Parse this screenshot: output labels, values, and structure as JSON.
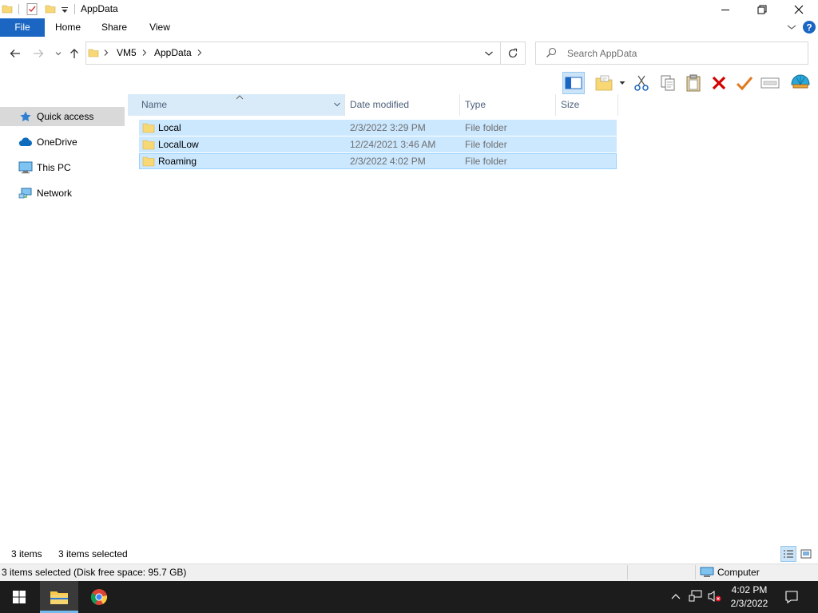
{
  "window": {
    "title": "AppData"
  },
  "ribbon": {
    "tabs": [
      {
        "label": "File"
      },
      {
        "label": "Home"
      },
      {
        "label": "Share"
      },
      {
        "label": "View"
      }
    ]
  },
  "address": {
    "breadcrumbs": [
      "VM5",
      "AppData"
    ],
    "search_placeholder": "Search AppData"
  },
  "columns": {
    "name": "Name",
    "date": "Date modified",
    "type": "Type",
    "size": "Size"
  },
  "sidebar": {
    "items": [
      {
        "label": "Quick access",
        "icon": "star-icon"
      },
      {
        "label": "OneDrive",
        "icon": "cloud-icon"
      },
      {
        "label": "This PC",
        "icon": "computer-icon"
      },
      {
        "label": "Network",
        "icon": "network-icon"
      }
    ]
  },
  "files": [
    {
      "name": "Local",
      "date": "2/3/2022 3:29 PM",
      "type": "File folder",
      "size": ""
    },
    {
      "name": "LocalLow",
      "date": "12/24/2021 3:46 AM",
      "type": "File folder",
      "size": ""
    },
    {
      "name": "Roaming",
      "date": "2/3/2022 4:02 PM",
      "type": "File folder",
      "size": ""
    }
  ],
  "status": {
    "count": "3 items",
    "selected": "3 items selected"
  },
  "details": {
    "left": "3 items selected (Disk free space: 95.7 GB)",
    "right": "Computer"
  },
  "taskbar": {
    "time": "4:02 PM",
    "date": "2/3/2022"
  },
  "colors": {
    "accent": "#1a66c2",
    "selection": "#cce8ff",
    "folder": "#f8d775"
  }
}
